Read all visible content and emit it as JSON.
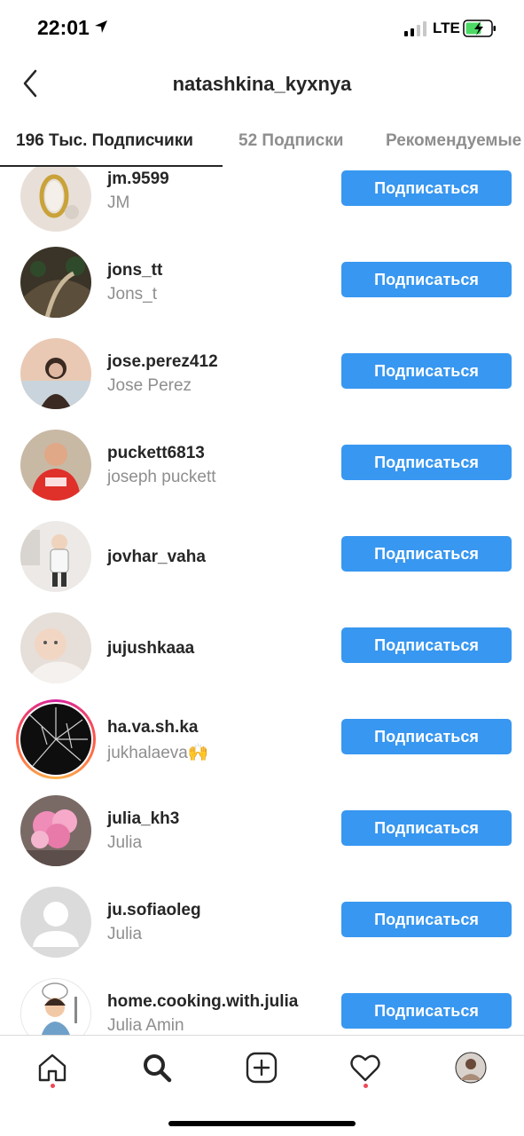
{
  "status_bar": {
    "time": "22:01",
    "network": "LTE"
  },
  "header": {
    "title": "natashkina_kyxnya"
  },
  "tabs": [
    {
      "label": "196 Тыс. Подписчики",
      "active": true
    },
    {
      "label": "52 Подписки",
      "active": false
    },
    {
      "label": "Рекомендуемые",
      "active": false
    }
  ],
  "follow_label": "Подписаться",
  "users": [
    {
      "username": "jm.9599",
      "fullname": "JM"
    },
    {
      "username": "jons_tt",
      "fullname": "Jons_t"
    },
    {
      "username": "jose.perez412",
      "fullname": "Jose Perez"
    },
    {
      "username": "puckett6813",
      "fullname": "joseph puckett"
    },
    {
      "username": "jovhar_vaha",
      "fullname": ""
    },
    {
      "username": "jujushkaaa",
      "fullname": ""
    },
    {
      "username": "ha.va.sh.ka",
      "fullname": "jukhalaeva🙌"
    },
    {
      "username": "julia_kh3",
      "fullname": "Julia"
    },
    {
      "username": "ju.sofiaoleg",
      "fullname": "Julia"
    },
    {
      "username": "home.cooking.with.julia",
      "fullname": "Julia Amin"
    }
  ],
  "colors": {
    "accent": "#3897f0",
    "notification_dot": "#ed4956",
    "secondary_text": "#8e8e8e"
  },
  "bottom_nav": [
    {
      "icon": "home-icon",
      "notification": true
    },
    {
      "icon": "search-icon",
      "notification": false
    },
    {
      "icon": "add-post-icon",
      "notification": false
    },
    {
      "icon": "heart-icon",
      "notification": true
    },
    {
      "icon": "profile-avatar-icon",
      "notification": false
    }
  ]
}
